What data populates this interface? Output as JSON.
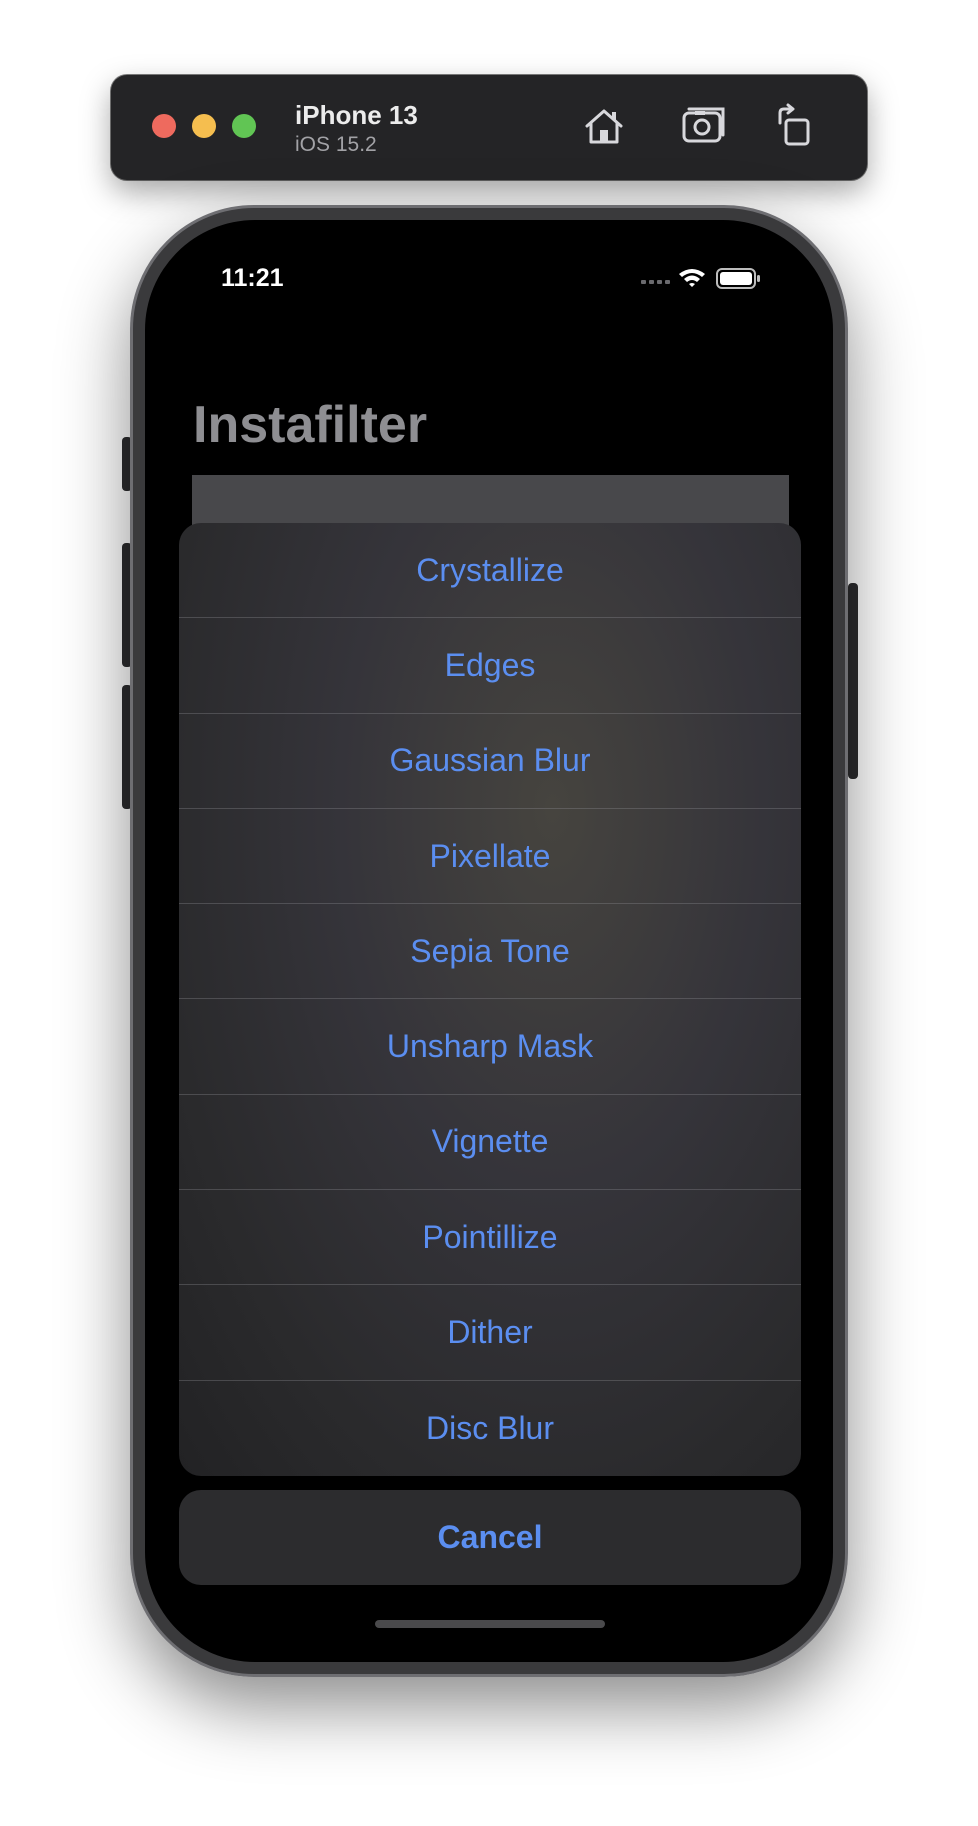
{
  "simulator": {
    "device_name": "iPhone 13",
    "os_version": "iOS 15.2",
    "toolbar_icons": [
      "home-icon",
      "screenshot-icon",
      "rotate-icon"
    ]
  },
  "status_bar": {
    "time": "11:21",
    "icons": [
      "cellular-icon",
      "wifi-icon",
      "battery-icon"
    ]
  },
  "app": {
    "title": "Instafilter"
  },
  "action_sheet": {
    "items": [
      {
        "label": "Crystallize"
      },
      {
        "label": "Edges"
      },
      {
        "label": "Gaussian Blur"
      },
      {
        "label": "Pixellate"
      },
      {
        "label": "Sepia Tone"
      },
      {
        "label": "Unsharp Mask"
      },
      {
        "label": "Vignette"
      },
      {
        "label": "Pointillize"
      },
      {
        "label": "Dither"
      },
      {
        "label": "Disc Blur"
      }
    ],
    "cancel_label": "Cancel"
  },
  "colors": {
    "accent": "#5b8ef0",
    "title_gray": "#8e8e92",
    "sheet_background": "#2c2c2e"
  }
}
